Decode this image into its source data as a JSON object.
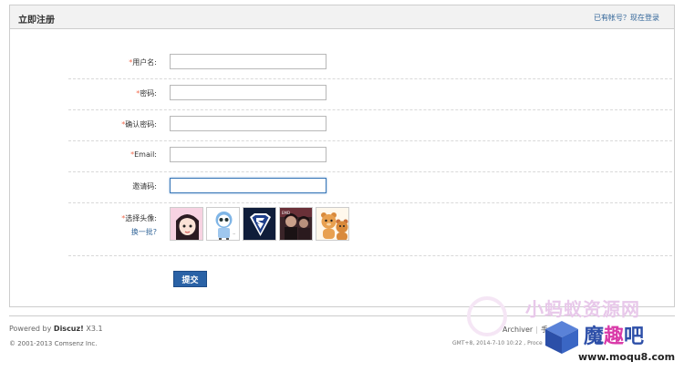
{
  "header": {
    "title": "立即注册",
    "login_link": "已有帐号？现在登录"
  },
  "form": {
    "required_mark": "*",
    "fields": [
      {
        "label": "用户名:",
        "required": true,
        "value": ""
      },
      {
        "label": "密码:",
        "required": true,
        "value": ""
      },
      {
        "label": "确认密码:",
        "required": true,
        "value": ""
      },
      {
        "label": "Email:",
        "required": true,
        "value": ""
      },
      {
        "label": "邀请码:",
        "required": false,
        "value": ""
      }
    ],
    "avatar": {
      "label": "选择头像:",
      "swap_link": "换一批?",
      "items": [
        "avatar-1",
        "avatar-2",
        "avatar-3",
        "avatar-4",
        "avatar-5"
      ]
    },
    "submit_label": "提交"
  },
  "footer": {
    "powered_prefix": "Powered by",
    "powered_brand": "Discuz!",
    "powered_version": "X3.1",
    "copyright": "© 2001-2013 Comsenz Inc.",
    "links": [
      "Archiver",
      "手"
    ],
    "gmt": "GMT+8, 2014-7-10 10:22 , Proce"
  },
  "watermark": {
    "line1": "小蚂蚁资源网",
    "line2_a": "魔",
    "line2_b": "趣",
    "line2_c": "吧",
    "url": "www.moqu8.com"
  },
  "colors": {
    "required": "#f26c4f",
    "link": "#336699",
    "submit_bg": "#2a62a6",
    "panel_head_bg": "#f2f2f2"
  }
}
